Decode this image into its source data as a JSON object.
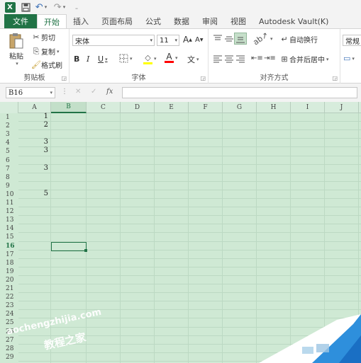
{
  "titlebar": {
    "logo": "X",
    "icons": [
      "save-icon",
      "undo-icon",
      "redo-icon",
      "customize-icon"
    ]
  },
  "tabs": [
    {
      "label": "文件",
      "kind": "file"
    },
    {
      "label": "开始",
      "kind": "active"
    },
    {
      "label": "插入",
      "kind": ""
    },
    {
      "label": "页面布局",
      "kind": ""
    },
    {
      "label": "公式",
      "kind": ""
    },
    {
      "label": "数据",
      "kind": ""
    },
    {
      "label": "审阅",
      "kind": ""
    },
    {
      "label": "视图",
      "kind": ""
    },
    {
      "label": "Autodesk Vault(K)",
      "kind": ""
    }
  ],
  "ribbon": {
    "clipboard": {
      "label": "剪贴板",
      "paste": "粘贴",
      "cut": "剪切",
      "copy": "复制",
      "format_painter": "格式刷"
    },
    "font": {
      "label": "字体",
      "font_name": "宋体",
      "font_size": "11",
      "grow": "A",
      "shrink": "A",
      "bold": "B",
      "italic": "I",
      "underline": "U",
      "font_color_letter": "A",
      "phonetic": "文"
    },
    "alignment": {
      "label": "对齐方式",
      "wrap_text": "自动换行",
      "merge_center": "合并后居中"
    },
    "number": {
      "format": "常规"
    },
    "colors": {
      "excel_green": "#217346",
      "fill_yellow": "#ffff00",
      "font_red": "#ff0000"
    }
  },
  "formula_bar": {
    "name_box": "B16",
    "cancel": "✕",
    "enter": "✓",
    "function": "fx",
    "formula": ""
  },
  "grid": {
    "columns": [
      "A",
      "B",
      "C",
      "D",
      "E",
      "F",
      "G",
      "H",
      "I",
      "J"
    ],
    "selected_column": "B",
    "rows": [
      "1",
      "2",
      "3",
      "4",
      "5",
      "6",
      "7",
      "8",
      "9",
      "10",
      "11",
      "12",
      "13",
      "14",
      "15",
      "16",
      "17",
      "18",
      "19",
      "20",
      "21",
      "22",
      "23",
      "24",
      "25",
      "26",
      "27",
      "28",
      "29"
    ],
    "selected_row": "16",
    "cells": [
      {
        "row": 1,
        "col": "A",
        "value": "1"
      },
      {
        "row": 2,
        "col": "A",
        "value": "2"
      },
      {
        "row": 4,
        "col": "A",
        "value": "3"
      },
      {
        "row": 5,
        "col": "A",
        "value": "3"
      },
      {
        "row": 7,
        "col": "A",
        "value": "3"
      },
      {
        "row": 10,
        "col": "A",
        "value": "5"
      }
    ],
    "active_cell": {
      "row": 16,
      "col": "B"
    }
  },
  "watermark": {
    "domain": "aochengzhijia.com",
    "name": "教程之家"
  }
}
